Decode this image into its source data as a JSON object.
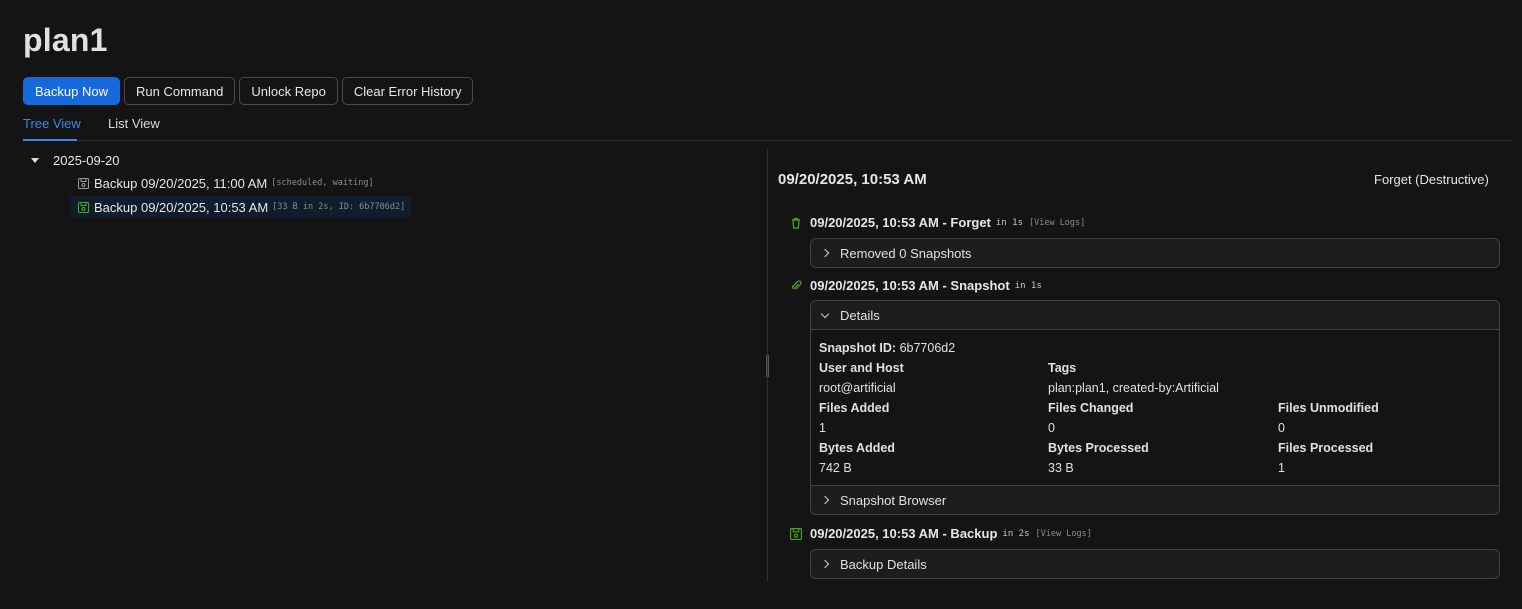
{
  "page": {
    "title": "plan1"
  },
  "toolbar": {
    "backup_now": "Backup Now",
    "run_command": "Run Command",
    "unlock_repo": "Unlock Repo",
    "clear_error_history": "Clear Error History"
  },
  "tabs": [
    {
      "label": "Tree View",
      "active": true
    },
    {
      "label": "List View",
      "active": false
    }
  ],
  "tree": {
    "group_label": "2025-09-20",
    "items": [
      {
        "label": "Backup 09/20/2025, 11:00 AM",
        "meta": "[scheduled, waiting]",
        "icon": "save-icon",
        "selected": false
      },
      {
        "label": "Backup 09/20/2025, 10:53 AM",
        "meta": "[33 B in 2s, ID: 6b7706d2]",
        "icon": "save-icon-success",
        "selected": true
      }
    ]
  },
  "detail": {
    "date": "09/20/2025, 10:53 AM",
    "forget_button": "Forget (Destructive)",
    "operations": [
      {
        "title": "09/20/2025, 10:53 AM - Forget",
        "duration": "in 1s",
        "link": "[View Logs]",
        "icon": "delete-icon",
        "panel_label": "Removed 0 Snapshots"
      },
      {
        "title": "09/20/2025, 10:53 AM - Snapshot",
        "duration": "in 1s",
        "icon": "paperclip-icon",
        "panel_label": "Details",
        "snapshot_browser_label": "Snapshot Browser",
        "snapshot_id_label": "Snapshot ID:",
        "snapshot_id": "6b7706d2",
        "fields": [
          {
            "label": "User and Host",
            "value": "root@artificial"
          },
          {
            "label": "Tags",
            "value": "plan:plan1, created-by:Artificial"
          },
          {
            "label": "Files Added",
            "value": "1"
          },
          {
            "label": "Files Changed",
            "value": "0"
          },
          {
            "label": "Files Unmodified",
            "value": "0"
          },
          {
            "label": "Bytes Added",
            "value": "742 B"
          },
          {
            "label": "Bytes Processed",
            "value": "33 B"
          },
          {
            "label": "Files Processed",
            "value": "1"
          }
        ]
      },
      {
        "title": "09/20/2025, 10:53 AM - Backup",
        "duration": "in 2s",
        "link": "[View Logs]",
        "icon": "save-icon-success",
        "panel_label": "Backup Details"
      }
    ]
  },
  "colors": {
    "accent": "#1668dc",
    "tab_active": "#3c89e8",
    "success": "#49aa19",
    "background": "#141414"
  }
}
